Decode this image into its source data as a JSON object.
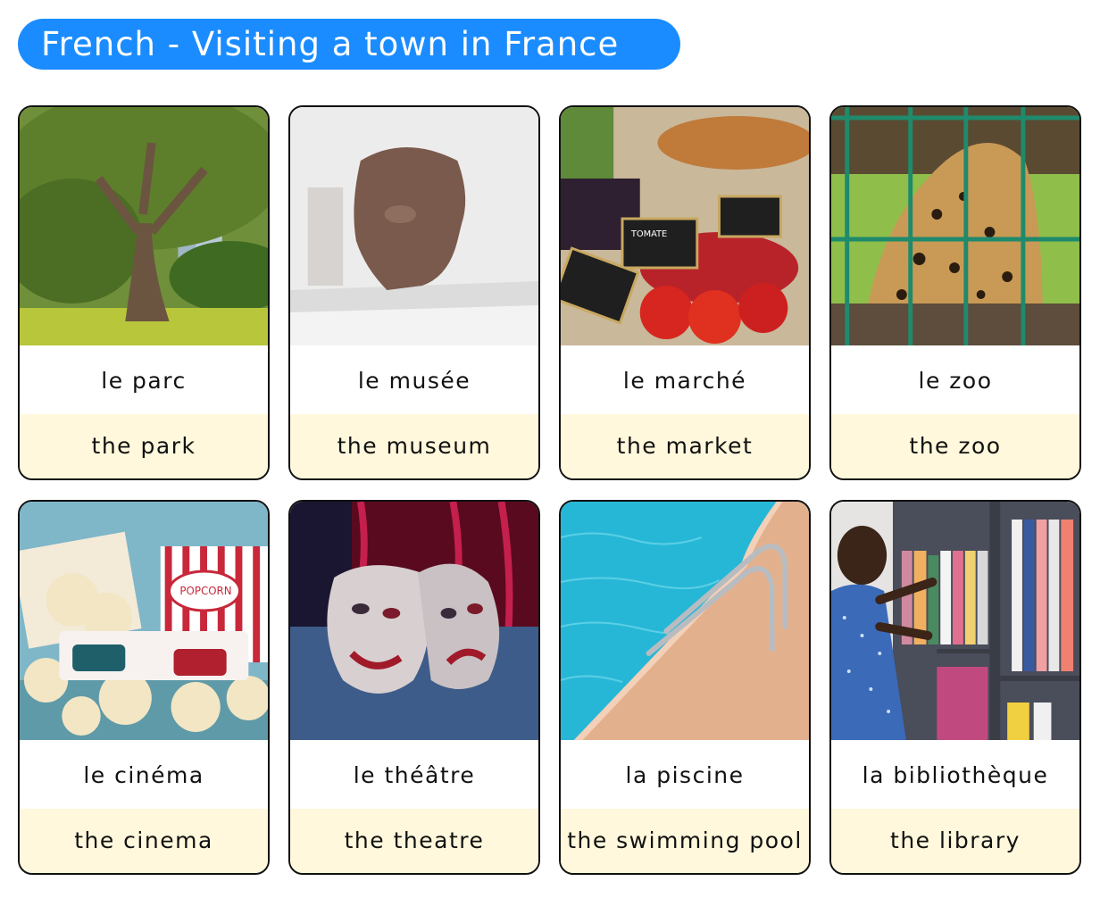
{
  "title": "French - Visiting a town in France",
  "colors": {
    "title_bg": "#1a8cff",
    "english_bg": "#fff8dc",
    "border": "#111111"
  },
  "cards": [
    {
      "image": "park-photo",
      "french": "le parc",
      "english": "the park"
    },
    {
      "image": "museum-photo",
      "french": "le musée",
      "english": "the museum"
    },
    {
      "image": "market-photo",
      "french": "le marché",
      "english": "the market"
    },
    {
      "image": "zoo-photo",
      "french": "le zoo",
      "english": "the zoo"
    },
    {
      "image": "cinema-photo",
      "french": "le cinéma",
      "english": "the cinema"
    },
    {
      "image": "theatre-photo",
      "french": "le théâtre",
      "english": "the theatre"
    },
    {
      "image": "pool-photo",
      "french": "la piscine",
      "english": "the swimming pool"
    },
    {
      "image": "library-photo",
      "french": "la bibliothèque",
      "english": "the library"
    }
  ],
  "image_text": {
    "popcorn_label": "POPCORN",
    "price_tag": "TOMATE"
  }
}
